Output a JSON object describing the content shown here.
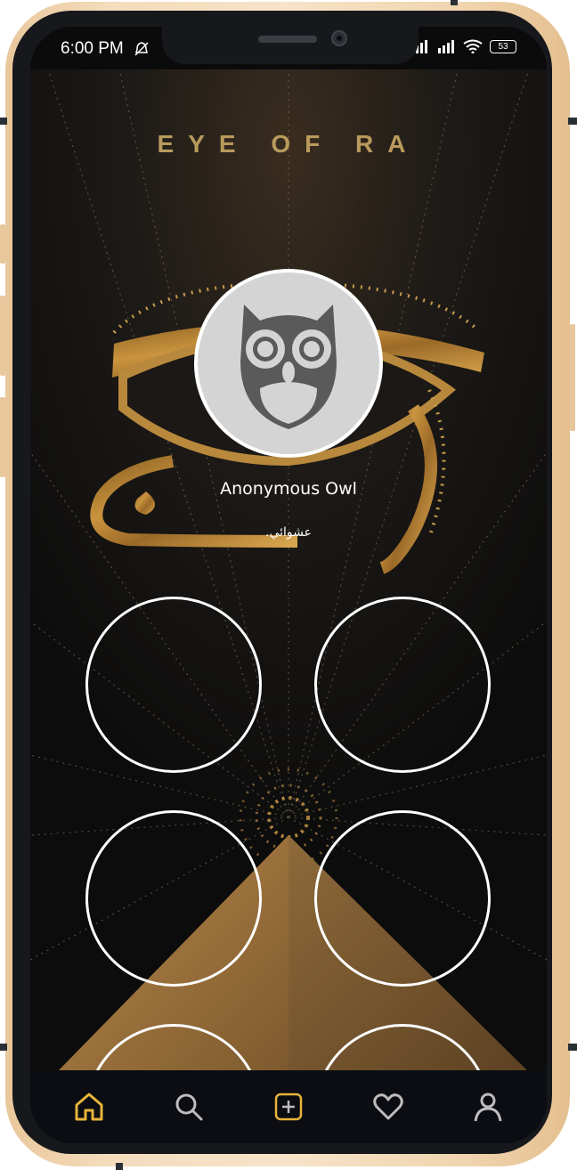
{
  "status_bar": {
    "time": "6:00 PM",
    "battery": "53"
  },
  "header": {
    "title": "EYE OF RA"
  },
  "profile": {
    "name": "Anonymous Owl",
    "status": "عشوائي."
  },
  "slots": [
    {
      "label": ""
    },
    {
      "label": ""
    },
    {
      "label": ""
    },
    {
      "label": ""
    },
    {
      "label": ""
    },
    {
      "label": ""
    }
  ],
  "bottom_nav": {
    "items": [
      {
        "icon": "home-icon",
        "active": true
      },
      {
        "icon": "search-icon",
        "active": false
      },
      {
        "icon": "add-icon",
        "active": false
      },
      {
        "icon": "heart-icon",
        "active": false
      },
      {
        "icon": "profile-icon",
        "active": false
      }
    ]
  },
  "colors": {
    "accent": "#e7b43a",
    "gold": "#b89a5c",
    "nav_icon": "#bdbdbd",
    "background": "#0e0e0f"
  }
}
